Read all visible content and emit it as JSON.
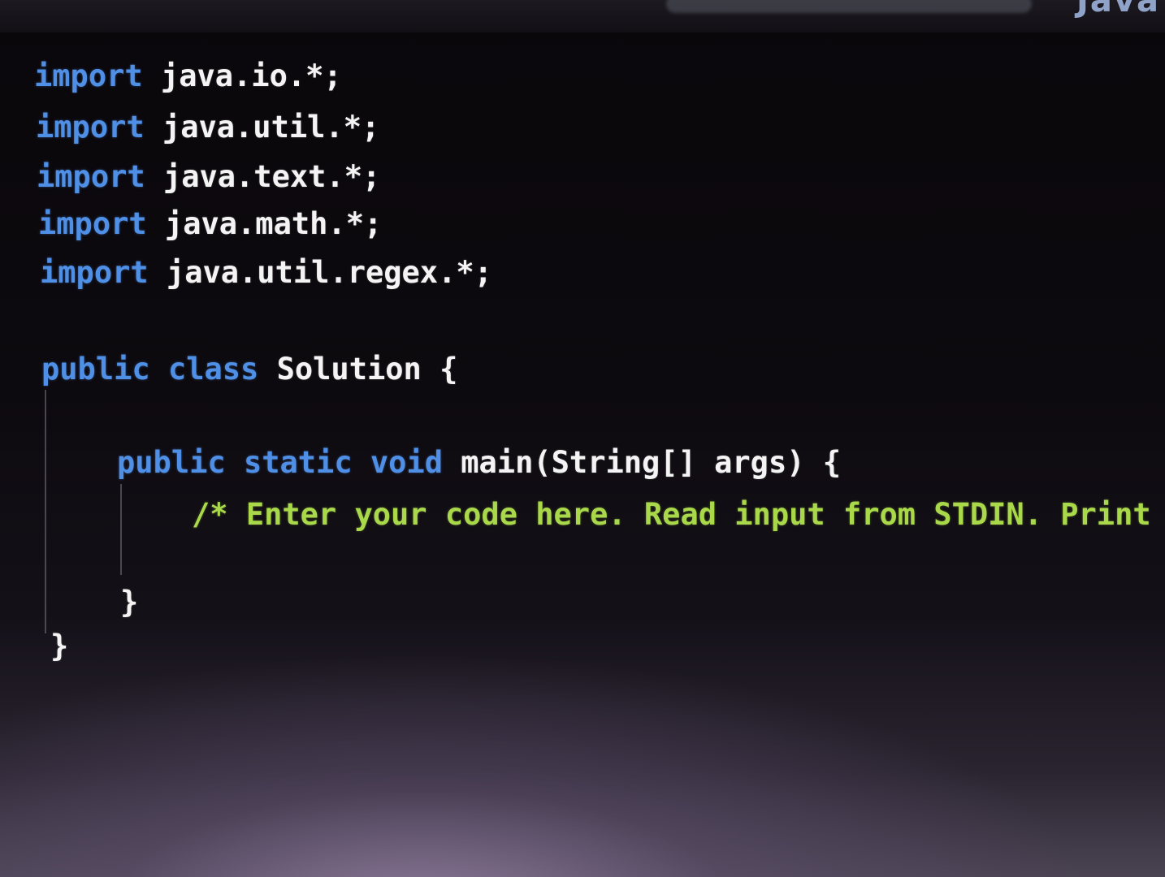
{
  "editor": {
    "language": "Java",
    "lines": [
      {
        "keyword": "import",
        "text": " java.io.*;"
      },
      {
        "keyword": "import",
        "text": " java.util.*;"
      },
      {
        "keyword": "import",
        "text": " java.text.*;"
      },
      {
        "keyword": "import",
        "text": " java.math.*;"
      },
      {
        "keyword": "import",
        "text": " java.util.regex.*;"
      },
      {
        "kw1": "public",
        "kw2": "class",
        "text": " Solution {"
      },
      {
        "kw1": "public",
        "kw2": "static",
        "kw3": "void",
        "text": " main(String[] args) {"
      },
      {
        "comment": "/* Enter your code here. Read input from STDIN. Print output to STDOUT. Your class should be named Solution. */"
      },
      {
        "text": "}"
      },
      {
        "text": "}"
      }
    ]
  }
}
